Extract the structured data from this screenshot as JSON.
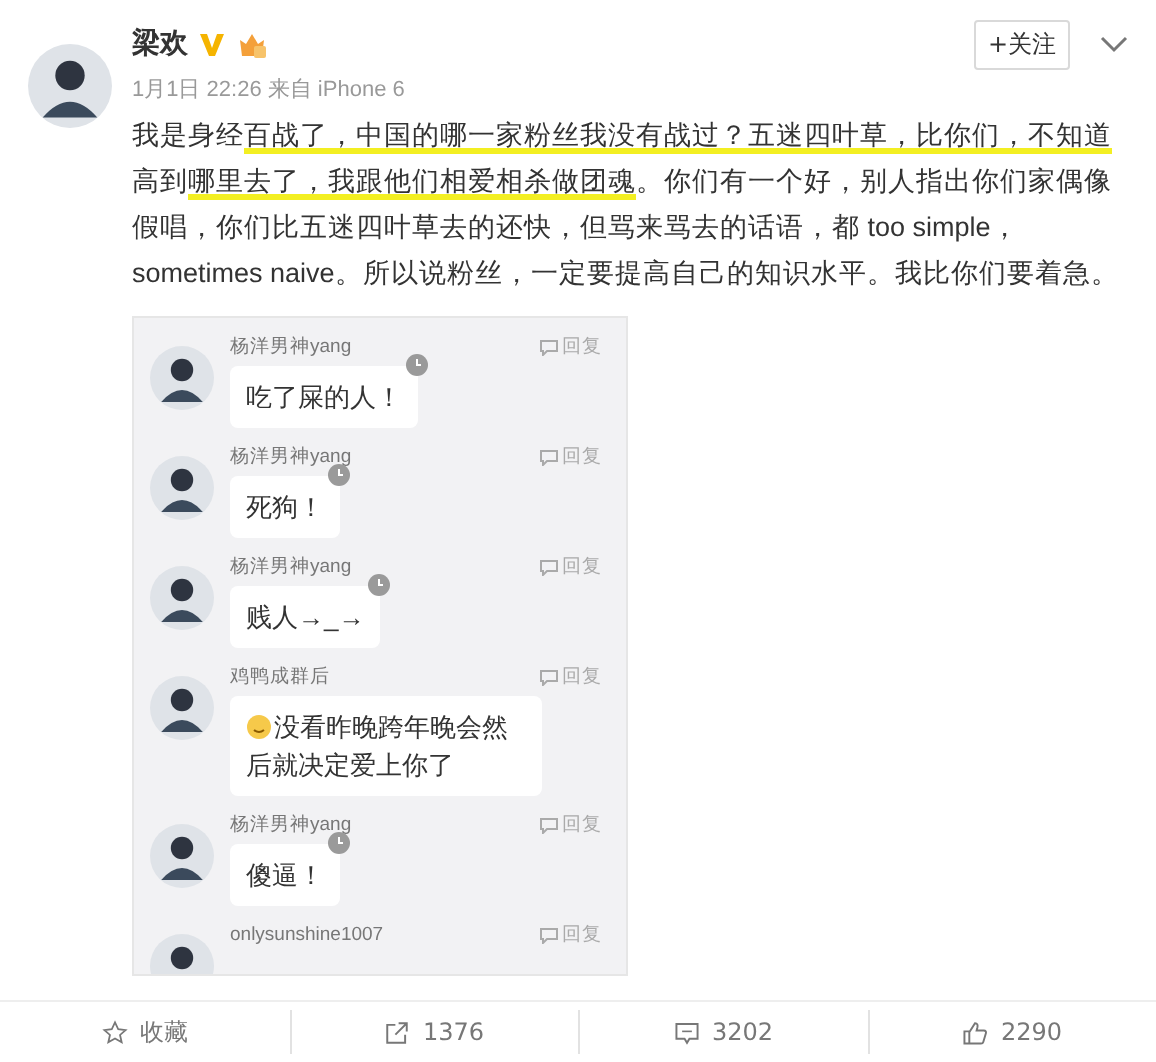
{
  "post": {
    "author": "梁欢",
    "verified": true,
    "member": true,
    "follow_label": "+关注",
    "meta": "1月1日 22:26 来自 iPhone 6",
    "body": [
      {
        "text": "我是身经",
        "highlighted": false
      },
      {
        "text": "百战了，中国的哪一家粉丝我没有战过？五迷四叶草，比你们，不知道",
        "highlighted": true
      },
      {
        "text": "高到",
        "highlighted": false
      },
      {
        "text": "哪里去了，我跟他们相爱相杀做团魂",
        "highlighted": true
      },
      {
        "text": "。你们有一个好，别人指出你们家偶像假唱，你们比五迷四叶草去的还快，但骂来骂去的话语，都 too simple，sometimes naive。所以说粉丝，一定要提高自己的知识水平。我比你们要着急。",
        "highlighted": false
      }
    ]
  },
  "screenshot": {
    "comments": [
      {
        "author": "杨洋男神yang",
        "reply": "回复",
        "text": "吃了屎的人！",
        "emoji": false,
        "clock": true
      },
      {
        "author": "杨洋男神yang",
        "reply": "回复",
        "text": "死狗！",
        "emoji": false,
        "clock": true
      },
      {
        "author": "杨洋男神yang",
        "reply": "回复",
        "text": "贱人→_→",
        "emoji": false,
        "clock": true
      },
      {
        "author": "鸡鸭成群后",
        "reply": "回复",
        "text": "没看昨晚跨年晚会然后就决定爱上你了",
        "emoji": true,
        "clock": false
      },
      {
        "author": "杨洋男神yang",
        "reply": "回复",
        "text": "傻逼！",
        "emoji": false,
        "clock": true
      },
      {
        "author": "onlysunshine1007",
        "reply": "回复"
      }
    ]
  },
  "actions": [
    {
      "kind": "favorite",
      "label": "收藏"
    },
    {
      "kind": "repost",
      "label": "1376"
    },
    {
      "kind": "comment",
      "label": "3202"
    },
    {
      "kind": "like",
      "label": "2290"
    }
  ]
}
